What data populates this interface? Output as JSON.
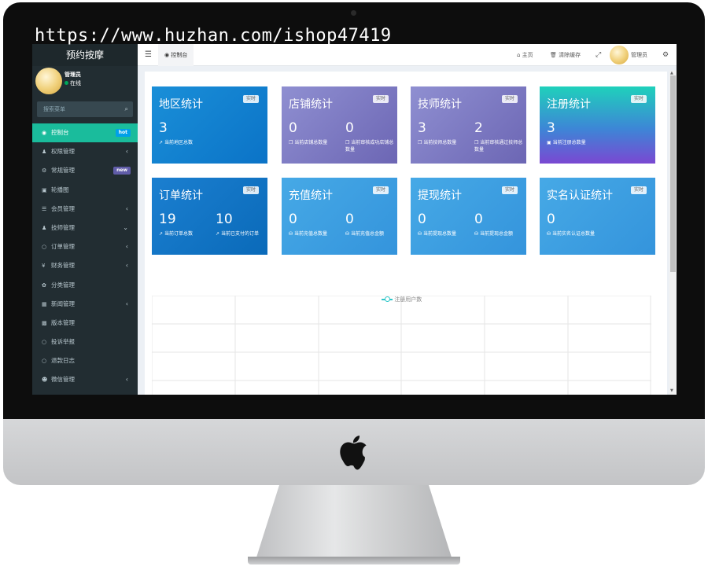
{
  "watermark": "https://www.huzhan.com/ishop47419",
  "sidebar": {
    "brand": "预约按摩",
    "user_name": "管理员",
    "user_status": "在线",
    "search_placeholder": "搜索菜单",
    "items": [
      {
        "icon": "dashboard-icon",
        "label": "控制台",
        "badge": "hot"
      },
      {
        "icon": "users-icon",
        "label": "权限管理",
        "chevron": "‹"
      },
      {
        "icon": "cogs-icon",
        "label": "常规管理",
        "badge": "new"
      },
      {
        "icon": "image-icon",
        "label": "轮播图"
      },
      {
        "icon": "list-icon",
        "label": "会员管理",
        "chevron": "‹"
      },
      {
        "icon": "user-icon",
        "label": "技师管理",
        "chevron": "⌄"
      },
      {
        "icon": "circle-icon",
        "label": "订单管理",
        "chevron": "‹"
      },
      {
        "icon": "yen-icon",
        "label": "财务管理",
        "chevron": "‹"
      },
      {
        "icon": "leaf-icon",
        "label": "分类管理"
      },
      {
        "icon": "calendar-icon",
        "label": "新闻管理",
        "chevron": "‹"
      },
      {
        "icon": "file-icon",
        "label": "版本管理"
      },
      {
        "icon": "circle-icon",
        "label": "投诉举报"
      },
      {
        "icon": "circle-icon",
        "label": "退款日志"
      },
      {
        "icon": "wechat-icon",
        "label": "微信管理",
        "chevron": "‹"
      }
    ]
  },
  "topbar": {
    "tab_label": "控制台",
    "home": "主页",
    "clear_cache": "清除缓存",
    "admin": "管理员"
  },
  "cards": [
    {
      "title": "地区统计",
      "tag": "实时",
      "stats": [
        {
          "value": "3",
          "label": "当前地区总数"
        }
      ]
    },
    {
      "title": "店铺统计",
      "tag": "实时",
      "stats": [
        {
          "value": "0",
          "label": "当前店铺总数量"
        },
        {
          "value": "0",
          "label": "当前审核成功店铺总数量"
        }
      ]
    },
    {
      "title": "技师统计",
      "tag": "实时",
      "stats": [
        {
          "value": "3",
          "label": "当前技师总数量"
        },
        {
          "value": "2",
          "label": "当前审核通过技师总数量"
        }
      ]
    },
    {
      "title": "注册统计",
      "tag": "实时",
      "stats": [
        {
          "value": "3",
          "label": "当前注册总数量"
        }
      ]
    },
    {
      "title": "订单统计",
      "tag": "实时",
      "stats": [
        {
          "value": "19",
          "label": "当前订单总数"
        },
        {
          "value": "10",
          "label": "当前已支付的订单"
        }
      ]
    },
    {
      "title": "充值统计",
      "tag": "实时",
      "stats": [
        {
          "value": "0",
          "label": "当前充值总数量"
        },
        {
          "value": "0",
          "label": "当前充值总金额"
        }
      ]
    },
    {
      "title": "提现统计",
      "tag": "实时",
      "stats": [
        {
          "value": "0",
          "label": "当前提现总数量"
        },
        {
          "value": "0",
          "label": "当前提现总金额"
        }
      ]
    },
    {
      "title": "实名认证统计",
      "tag": "实时",
      "stats": [
        {
          "value": "0",
          "label": "当前实名认证总数量"
        }
      ]
    }
  ],
  "chart": {
    "legend": "注册用户数"
  }
}
